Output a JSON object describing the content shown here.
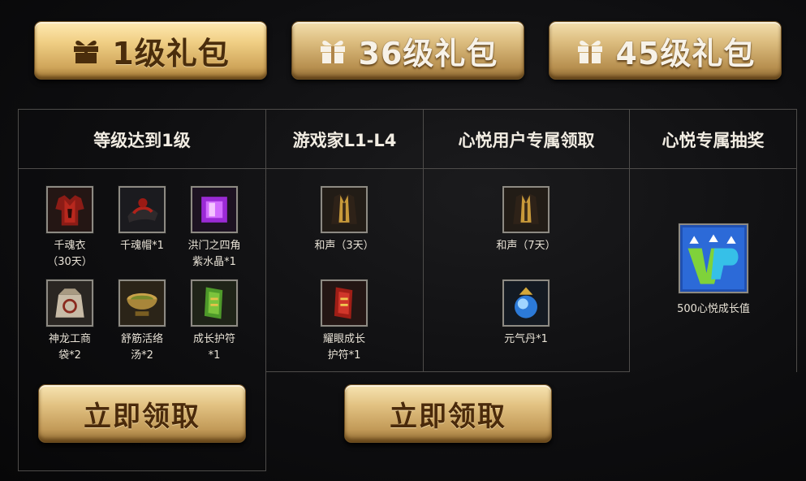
{
  "tabs": [
    {
      "label": "1级礼包"
    },
    {
      "label": "36级礼包"
    },
    {
      "label": "45级礼包"
    }
  ],
  "columns": [
    {
      "header": "等级达到1级"
    },
    {
      "header": "游戏家L1-L4"
    },
    {
      "header": "心悦用户专属领取"
    },
    {
      "header": "心悦专属抽奖"
    }
  ],
  "level1_items": [
    {
      "line1": "千魂衣",
      "line2": "（30天）",
      "icon": "red-armor-icon"
    },
    {
      "line1": "千魂帽*1",
      "line2": "",
      "icon": "dark-hat-icon"
    },
    {
      "line1": "洪门之四角",
      "line2": "紫水晶*1",
      "icon": "purple-gem-icon"
    },
    {
      "line1": "神龙工商",
      "line2": "袋*2",
      "icon": "bag-icon"
    },
    {
      "line1": "舒筋活络",
      "line2": "汤*2",
      "icon": "soup-bowl-icon"
    },
    {
      "line1": "成长护符",
      "line2": "*1",
      "icon": "green-talisman-icon"
    }
  ],
  "gamer_items": [
    {
      "line1": "和声（3天）",
      "line2": "",
      "icon": "gold-robe-icon"
    },
    {
      "line1": "耀眼成长",
      "line2": "护符*1",
      "icon": "red-talisman-icon"
    }
  ],
  "xinyue_items": [
    {
      "line1": "和声（7天）",
      "line2": "",
      "icon": "gold-robe-icon"
    },
    {
      "line1": "元气丹*1",
      "line2": "",
      "icon": "blue-orb-icon"
    }
  ],
  "lottery_item": {
    "label": "500心悦成长值",
    "icon": "vip-icon"
  },
  "buttons": {
    "claim_left": "立即领取",
    "claim_center": "立即领取"
  }
}
